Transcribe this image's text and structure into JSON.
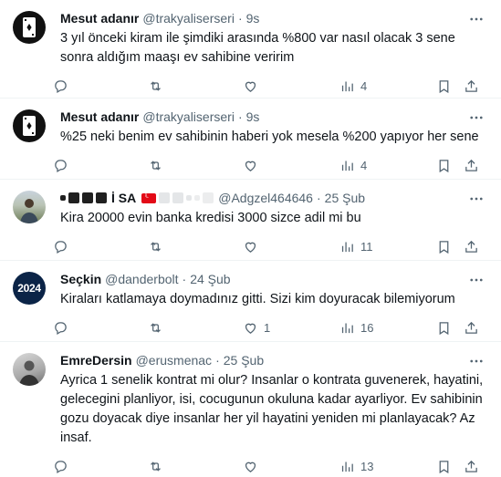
{
  "tweets": [
    {
      "name": "Mesut adanır",
      "handle": "@trakyaliserseri",
      "sep": "·",
      "time": "9s",
      "text": "3 yıl önceki kiram ile şimdiki arasında %800 var nasıl olacak 3 sene sonra aldığım maaşı ev sahibine veririm",
      "replies": "",
      "retweets": "",
      "likes": "",
      "views": "4",
      "avatar": "card-avatar"
    },
    {
      "name": "Mesut adanır",
      "handle": "@trakyaliserseri",
      "sep": "·",
      "time": "9s",
      "text": "%25 neki benim ev sahibinin haberi yok mesela %200 yapıyor her sene",
      "replies": "",
      "retweets": "",
      "likes": "",
      "views": "4",
      "avatar": "card-avatar"
    },
    {
      "name": "İ SA",
      "handle": "@Adgzel464646",
      "sep": "·",
      "time": "25 Şub",
      "text": "Kira 20000 evin banka kredisi 3000 sizce adil mi bu",
      "replies": "",
      "retweets": "",
      "likes": "",
      "views": "11",
      "avatar": "photo-avatar"
    },
    {
      "name": "Seçkin",
      "handle": "@danderbolt",
      "sep": "·",
      "time": "24 Şub",
      "text": "Kiraları katlamaya doymadınız gitti. Sizi kim doyuracak bilemiyorum",
      "replies": "",
      "retweets": "",
      "likes": "1",
      "views": "16",
      "avatar": "2024-avatar",
      "avatar_text": "2024"
    },
    {
      "name": "EmreDersin",
      "handle": "@erusmenac",
      "sep": "·",
      "time": "25 Şub",
      "text": "Ayrica 1 senelik kontrat mi olur? Insanlar o kontrata guvenerek, hayatini, gelecegini planliyor, isi, cocugunun okuluna kadar ayarliyor. Ev sahibinin gozu doyacak diye insanlar her yil hayatini yeniden mi planlayacak? Az insaf.",
      "replies": "",
      "retweets": "",
      "likes": "",
      "views": "13",
      "avatar": "photo-avatar"
    }
  ],
  "colors": {
    "text": "#0f1419",
    "secondary": "#536471",
    "border": "#eff3f4",
    "avatar_dark": "#111111",
    "avatar_navy": "#0b2447"
  }
}
